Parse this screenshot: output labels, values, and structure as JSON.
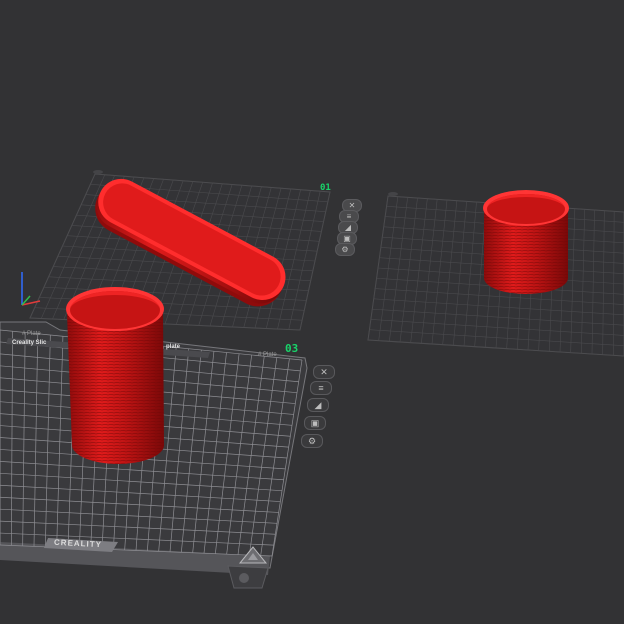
{
  "app": {
    "viewport_background": "#323234"
  },
  "plates": [
    {
      "number": "01",
      "tag": "",
      "title": "",
      "brand": "",
      "actions": [
        {
          "name": "close-icon",
          "glyph": "✕"
        },
        {
          "name": "arrange-icon",
          "glyph": "≡"
        },
        {
          "name": "orient-icon",
          "glyph": "◢"
        },
        {
          "name": "lock-icon",
          "glyph": "▣"
        },
        {
          "name": "settings-icon",
          "glyph": "⚙"
        }
      ]
    },
    {
      "number": "",
      "tag": "",
      "title": "",
      "brand": "",
      "actions": []
    },
    {
      "number": "03",
      "tag_left": "# Plate",
      "tag_right": "# Plate",
      "title_left": "Creality Slic",
      "title_right": "plate",
      "brand": "CREALITY",
      "actions": [
        {
          "name": "close-icon",
          "glyph": "✕"
        },
        {
          "name": "arrange-icon",
          "glyph": "≡"
        },
        {
          "name": "orient-icon",
          "glyph": "◢"
        },
        {
          "name": "lock-icon",
          "glyph": "▣"
        },
        {
          "name": "settings-icon",
          "glyph": "⚙"
        }
      ]
    }
  ],
  "colors": {
    "model": "#e01b1b",
    "model_dark": "#9e0c0c",
    "model_light": "#ff3b3b",
    "plate_line": "#4f4f52",
    "plate_fill": "#333336",
    "active_plate_fill": "#3a3a3d",
    "active_plate_line": "#77777b",
    "plate_number": "#19d36a"
  }
}
